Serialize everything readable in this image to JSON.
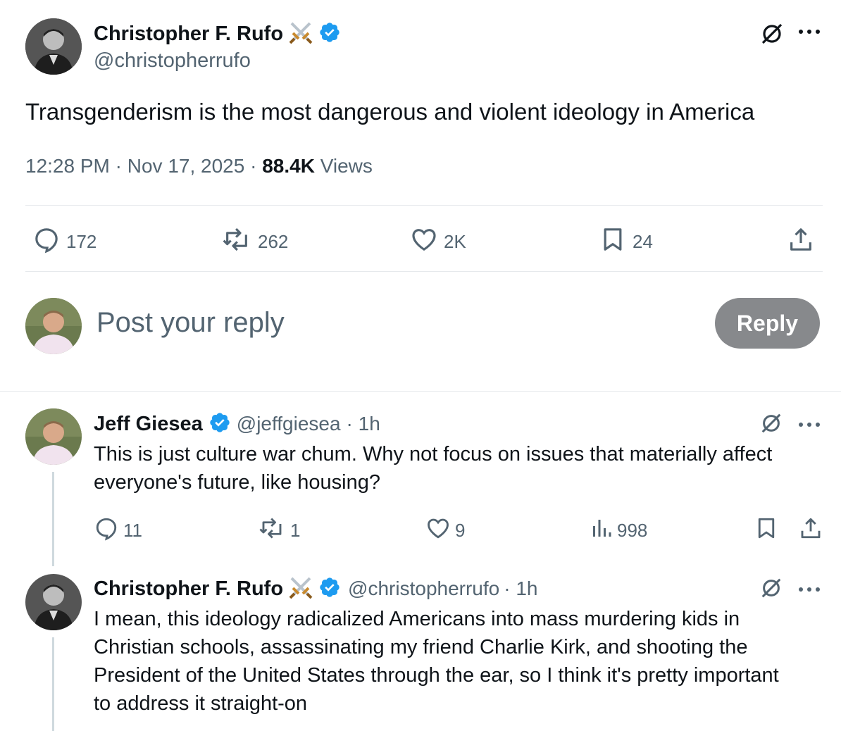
{
  "main_post": {
    "author_name": "Christopher F. Rufo",
    "author_handle": "@christopherrufo",
    "text": "Transgenderism is the most dangerous and violent ideology in America",
    "time": "12:28 PM",
    "date": "Nov 17, 2025",
    "views_count": "88.4K",
    "views_label": "Views",
    "sep": "·",
    "stats": {
      "replies": "172",
      "reposts": "262",
      "likes": "2K",
      "bookmarks": "24"
    }
  },
  "composer": {
    "placeholder": "Post your reply",
    "button_label": "Reply"
  },
  "replies": [
    {
      "author_name": "Jeff Giesea",
      "author_handle": "@jeffgiesea",
      "age": "· 1h",
      "text": "This is just culture war chum. Why not focus on issues that materially affect everyone's future, like housing?",
      "stats": {
        "replies": "11",
        "reposts": "1",
        "likes": "9",
        "views": "998"
      }
    },
    {
      "author_name": "Christopher F. Rufo",
      "author_handle": "@christopherrufo",
      "age": "· 1h",
      "text": "I mean, this ideology radicalized Americans into mass murdering kids in Christian schools, assassinating my friend Charlie Kirk, and shooting the President of the United States through the ear, so I think it's pretty important to address it straight-on"
    }
  ],
  "icons": {
    "verified": "verified-badge-icon",
    "swords": "crossed-swords-emoji-icon",
    "grok": "grok-icon",
    "more": "more-dots-icon",
    "reply": "reply-icon",
    "repost": "repost-icon",
    "like": "heart-icon",
    "bookmark": "bookmark-icon",
    "share": "share-icon",
    "views": "views-chart-icon"
  },
  "colors": {
    "verified_blue": "#1d9bf0",
    "muted_text": "#536471",
    "reply_button_bg": "#87898c"
  }
}
